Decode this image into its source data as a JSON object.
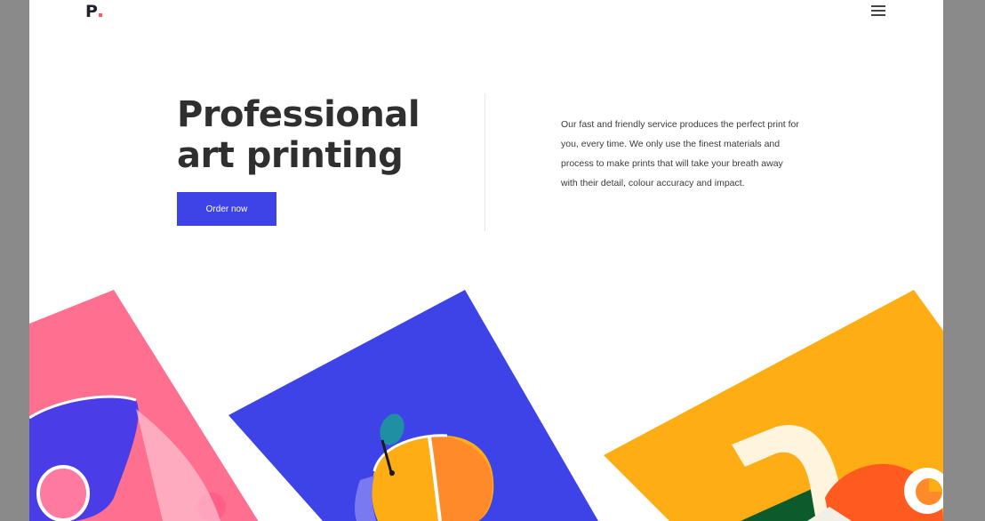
{
  "header": {
    "logo_text": "P",
    "menu_icon": "hamburger-icon"
  },
  "hero": {
    "title_line1": "Professional",
    "title_line2": "art printing",
    "cta_label": "Order now",
    "description": "Our fast and friendly service produces the perfect print for you, every time. We only use the finest materials and process to make prints that will take your breath away with their detail, colour accuracy and impact."
  },
  "colors": {
    "background_frame": "#8a8a8a",
    "page": "#ffffff",
    "accent_blue": "#3d43e6",
    "pink": "#ff6f8f",
    "yellow": "#ffad14",
    "orange": "#ff8a2a",
    "teal": "#1f8fa3",
    "green": "#0d5a2c",
    "logo_dot": "#ff5a5f"
  },
  "artworks": [
    {
      "name": "pink-print",
      "color": "pink"
    },
    {
      "name": "blue-print-orange",
      "color": "accent_blue"
    },
    {
      "name": "yellow-print",
      "color": "yellow"
    }
  ]
}
